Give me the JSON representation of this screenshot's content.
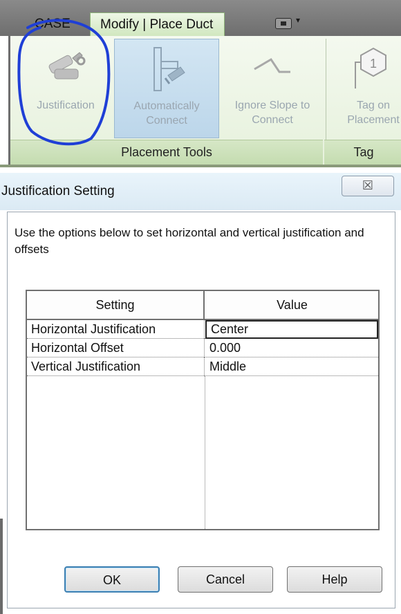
{
  "ribbon": {
    "tabs": {
      "case": "CASE",
      "modify": "Modify | Place Duct"
    },
    "buttons": {
      "justification": "Justification",
      "auto_connect": "Automatically Connect",
      "ignore_slope": "Ignore Slope to Connect",
      "tag_on_placement": "Tag on Placement"
    },
    "groups": {
      "placement_tools": "Placement Tools",
      "tag": "Tag"
    },
    "tag_number": "1"
  },
  "dialog": {
    "title": "Justification Setting",
    "close_glyph": "☒",
    "description": "Use the options below to set horizontal and vertical justification and offsets",
    "table": {
      "headers": [
        "Setting",
        "Value"
      ],
      "rows": [
        {
          "setting": "Horizontal Justification",
          "value": "Center"
        },
        {
          "setting": "Horizontal Offset",
          "value": "0.000"
        },
        {
          "setting": "Vertical Justification",
          "value": "Middle"
        }
      ]
    },
    "buttons": {
      "ok": "OK",
      "cancel": "Cancel",
      "help": "Help"
    }
  },
  "colors": {
    "ribbon_panel": "#e6f1dc",
    "active_button": "#bcd6ea",
    "annotation_marker": "#1f3fd6",
    "title_bar": "#dbeaf4"
  }
}
